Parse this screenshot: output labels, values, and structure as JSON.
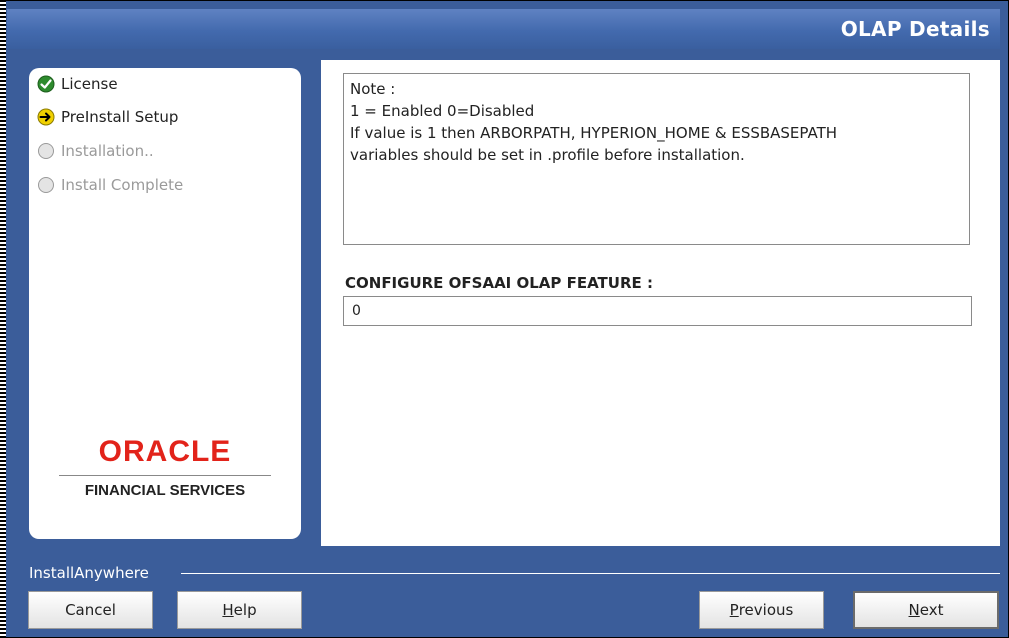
{
  "window": {
    "title": "OLAP Details"
  },
  "steps": [
    {
      "label": "License",
      "status": "complete",
      "icon": "check-icon"
    },
    {
      "label": "PreInstall Setup",
      "status": "current",
      "icon": "arrow-right-icon"
    },
    {
      "label": "Installation..",
      "status": "pending",
      "icon": "circle-icon"
    },
    {
      "label": "Install Complete",
      "status": "pending",
      "icon": "circle-icon"
    }
  ],
  "logo": {
    "brand": "ORACLE",
    "subtitle": "FINANCIAL SERVICES"
  },
  "note": {
    "lines": [
      "Note :",
      "1 = Enabled 0=Disabled",
      "If value is 1 then ARBORPATH, HYPERION_HOME & ESSBASEPATH",
      "variables should be set in .profile before installation."
    ]
  },
  "config": {
    "label": "CONFIGURE OFSAAI OLAP FEATURE :",
    "value": "0"
  },
  "footer": {
    "brand": "InstallAnywhere",
    "buttons": {
      "cancel": "Cancel",
      "help_mn": "H",
      "help_rest": "elp",
      "previous_mn": "P",
      "previous_rest": "revious",
      "next_mn": "N",
      "next_rest": "ext"
    }
  },
  "colors": {
    "frame": "#3b5d9a",
    "oracle_red": "#e2231a",
    "check_green": "#2e8b2e",
    "arrow_yellow": "#f0d000"
  }
}
